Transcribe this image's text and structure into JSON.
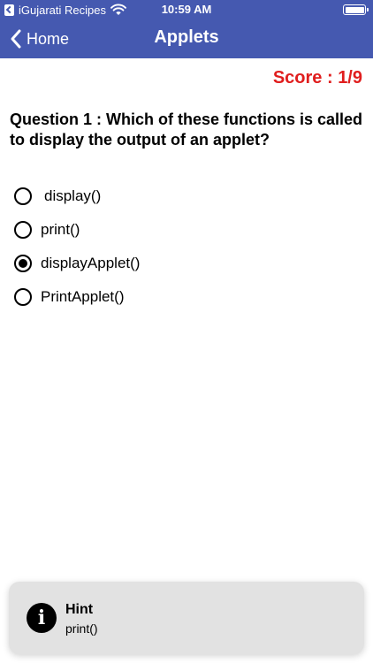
{
  "status_bar": {
    "back_app": "iGujarati Recipes",
    "time": "10:59 AM",
    "battery_level": 1.0
  },
  "nav": {
    "back_label": "Home",
    "title": "Applets"
  },
  "score": {
    "text": "Score : 1/9"
  },
  "question": {
    "text": "Question 1 : Which of these functions is called to display the output of an applet?"
  },
  "options": [
    {
      "label": "display()",
      "selected": false
    },
    {
      "label": "print()",
      "selected": false
    },
    {
      "label": "displayApplet()",
      "selected": true
    },
    {
      "label": "PrintApplet()",
      "selected": false
    }
  ],
  "hint": {
    "icon": "info-icon",
    "title": "Hint",
    "text": "print()"
  },
  "colors": {
    "header": "#4559b0",
    "score": "#e01e1e",
    "hint_bg": "#e2e2e2"
  }
}
